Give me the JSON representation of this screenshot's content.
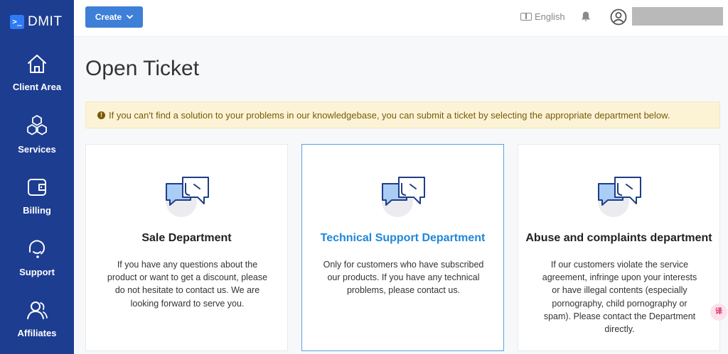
{
  "brand": {
    "mark": ">_",
    "name": "DMIT"
  },
  "sidebar": {
    "items": [
      {
        "label": "Client Area",
        "icon": "home-icon"
      },
      {
        "label": "Services",
        "icon": "cubes-icon"
      },
      {
        "label": "Billing",
        "icon": "wallet-icon"
      },
      {
        "label": "Support",
        "icon": "support-icon"
      },
      {
        "label": "Affiliates",
        "icon": "users-icon"
      }
    ]
  },
  "topbar": {
    "create_label": "Create",
    "language_label": "English",
    "icons": [
      "translate-icon",
      "bell-icon",
      "user-icon"
    ]
  },
  "page": {
    "title": "Open Ticket",
    "alert": "If you can't find a solution to your problems in our knowledgebase, you can submit a ticket by selecting the appropriate department below."
  },
  "departments": [
    {
      "title": "Sale Department",
      "description": "If you have any questions about the product or want to get a discount, please do not hesitate to contact us. We are looking forward to serve you."
    },
    {
      "title": "Technical Support Department",
      "description": "Only for customers who have subscribed our products. If you have any technical problems, please contact us."
    },
    {
      "title": "Abuse and complaints department",
      "description": "If our customers violate the service agreement, infringe upon your interests or have illegal contents (especially pornography, child pornography or spam). Please contact the Department directly."
    }
  ],
  "colors": {
    "sidebar": "#1d3d91",
    "primary": "#3e7fd8",
    "active_title": "#1f87d8",
    "alert_bg": "#fcf3d7",
    "alert_text": "#7a5a06"
  },
  "floating_widget": {
    "text": "译"
  }
}
